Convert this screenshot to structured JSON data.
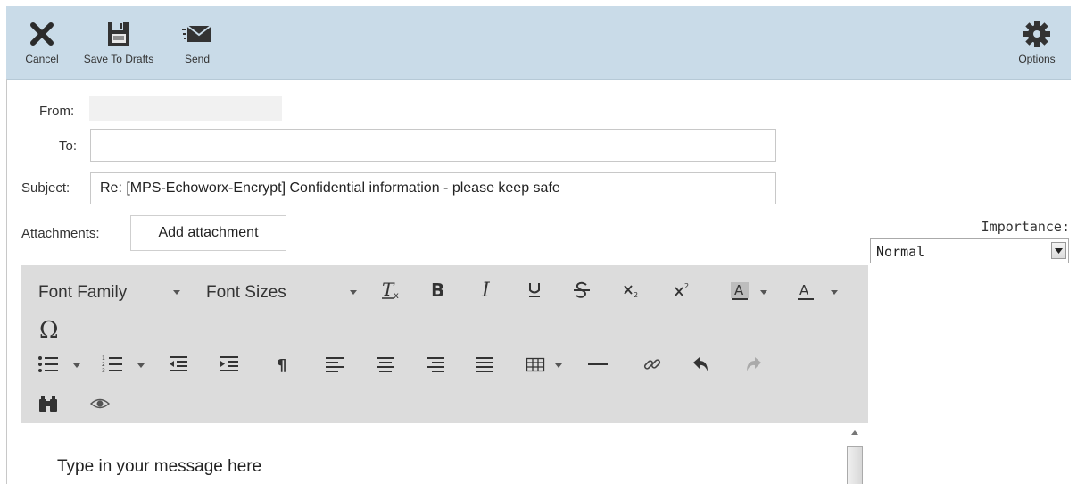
{
  "toolbar": {
    "cancel_label": "Cancel",
    "save_label": "Save To Drafts",
    "send_label": "Send",
    "options_label": "Options"
  },
  "form": {
    "from_label": "From:",
    "from_value": "",
    "to_label": "To:",
    "to_value": "",
    "subject_label": "Subject:",
    "subject_value": "Re: [MPS-Echoworx-Encrypt] Confidential information - please keep safe",
    "attachments_label": "Attachments:",
    "add_attachment_label": "Add attachment",
    "importance_label": "Importance:",
    "importance_value": "Normal"
  },
  "editor": {
    "font_family_label": "Font Family",
    "font_sizes_label": "Font Sizes",
    "body_placeholder": "Type in your message here"
  },
  "colors": {
    "toolbar_bg": "#c9dbe8",
    "editor_toolbar_bg": "#dcdcdc"
  }
}
